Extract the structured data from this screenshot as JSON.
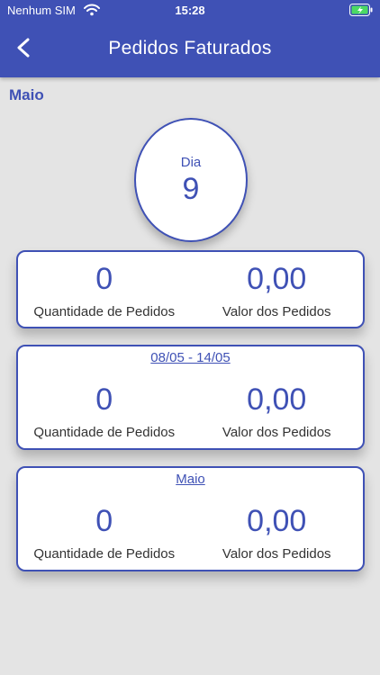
{
  "status_bar": {
    "carrier": "Nenhum SIM",
    "time": "15:28"
  },
  "header": {
    "title": "Pedidos Faturados",
    "back_icon": "chevron-left-icon"
  },
  "month": "Maio",
  "day_bubble": {
    "label": "Dia",
    "number": "9"
  },
  "cards": [
    {
      "period": "",
      "quantity_value": "0",
      "quantity_label": "Quantidade de Pedidos",
      "amount_value": "0,00",
      "amount_label": "Valor dos Pedidos"
    },
    {
      "period": "08/05  -  14/05",
      "quantity_value": "0",
      "quantity_label": "Quantidade de Pedidos",
      "amount_value": "0,00",
      "amount_label": "Valor dos Pedidos"
    },
    {
      "period": "Maio",
      "quantity_value": "0",
      "quantity_label": "Quantidade de Pedidos",
      "amount_value": "0,00",
      "amount_label": "Valor dos Pedidos"
    }
  ],
  "colors": {
    "primary": "#3f51b5",
    "background": "#e4e4e4",
    "card": "#ffffff",
    "battery": "#4cd964"
  }
}
